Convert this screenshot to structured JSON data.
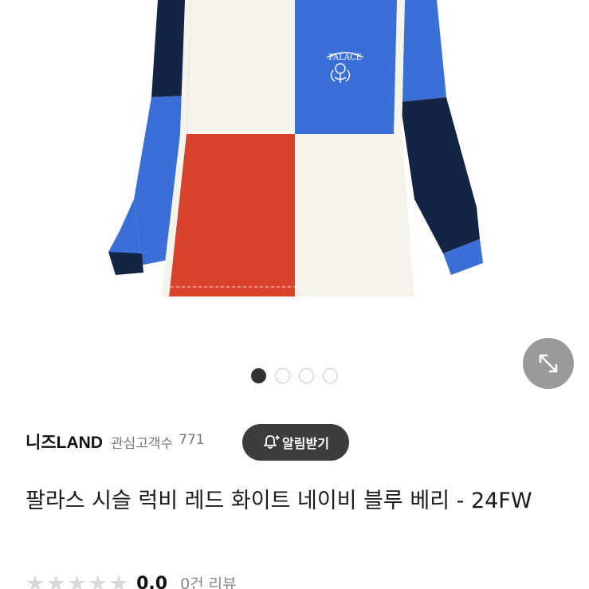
{
  "product_image": {
    "alt": "",
    "crest_text": "PALACE",
    "colors": {
      "royal_blue": "#3a6fd8",
      "navy": "#142445",
      "cream": "#f6f3ea",
      "red": "#d9432c"
    }
  },
  "gallery": {
    "total": 4,
    "active_index": 0
  },
  "icons": {
    "expand": "expand-arrows-icon",
    "bell": "bell-plus-icon",
    "star": "star-icon"
  },
  "shop": {
    "name": "니즈LAND",
    "followers_label": "관심고객수",
    "followers_count": "771",
    "notify_label": "알림받기"
  },
  "product": {
    "title": "팔라스 시슬 럭비 레드 화이트 네이비 블루 베리 - 24FW"
  },
  "rating": {
    "value": "0.0",
    "review_label": "0건 리뷰",
    "stars_filled": 0,
    "stars_total": 5
  }
}
